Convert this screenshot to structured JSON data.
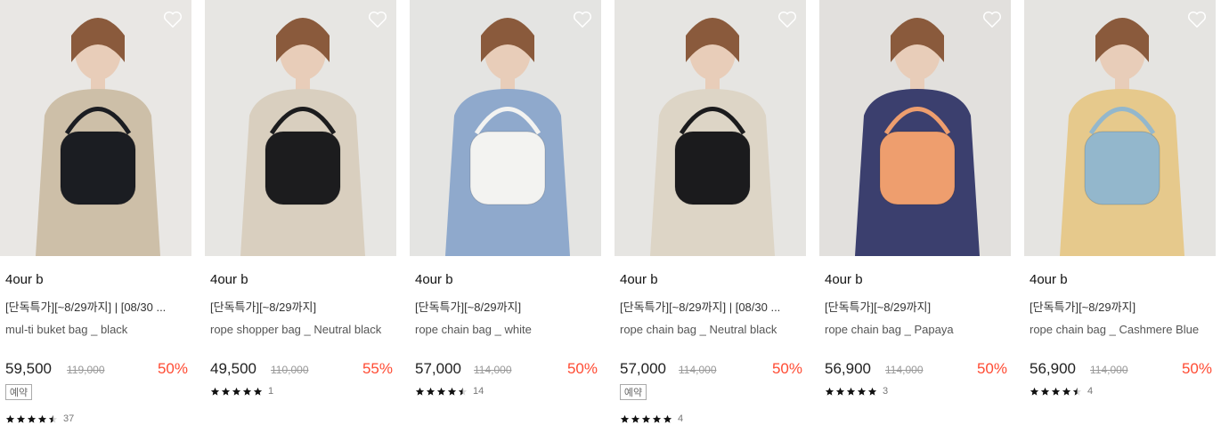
{
  "products": [
    {
      "brand": "4our b",
      "promo": "[단독특가][~8/29까지] | [08/30 ...",
      "name": "mul-ti buket bag _ black",
      "price": "59,500",
      "original_price": "119,000",
      "discount": "50%",
      "badge": "예약",
      "reviews": "37",
      "stars": "4.5",
      "bag_color": "#1b1d22",
      "bg": "#e9e7e4",
      "outfit": "#cdbfa8"
    },
    {
      "brand": "4our b",
      "promo": "[단독특가][~8/29까지]",
      "name": "rope shopper bag _ Neutral black",
      "price": "49,500",
      "original_price": "110,000",
      "discount": "55%",
      "badge": "",
      "reviews": "1",
      "stars": "5",
      "bag_color": "#1c1c1e",
      "bg": "#e7e6e3",
      "outfit": "#d9cfbf"
    },
    {
      "brand": "4our b",
      "promo": "[단독특가][~8/29까지]",
      "name": "rope chain bag _ white",
      "price": "57,000",
      "original_price": "114,000",
      "discount": "50%",
      "badge": "",
      "reviews": "14",
      "stars": "4.5",
      "bag_color": "#f3f3f1",
      "bg": "#e4e4e2",
      "outfit": "#8fa9cc"
    },
    {
      "brand": "4our b",
      "promo": "[단독특가][~8/29까지] | [08/30 ...",
      "name": "rope chain bag _ Neutral black",
      "price": "57,000",
      "original_price": "114,000",
      "discount": "50%",
      "badge": "예약",
      "reviews": "4",
      "stars": "5",
      "bag_color": "#1b1b1d",
      "bg": "#e6e5e2",
      "outfit": "#ddd5c6"
    },
    {
      "brand": "4our b",
      "promo": "[단독특가][~8/29까지]",
      "name": "rope chain bag _ Papaya",
      "price": "56,900",
      "original_price": "114,000",
      "discount": "50%",
      "badge": "",
      "reviews": "3",
      "stars": "5",
      "bag_color": "#ee9e6e",
      "bg": "#e2e0dd",
      "outfit": "#3b3f6e"
    },
    {
      "brand": "4our b",
      "promo": "[단독특가][~8/29까지]",
      "name": "rope chain bag _ Cashmere Blue",
      "price": "56,900",
      "original_price": "114,000",
      "discount": "50%",
      "badge": "",
      "reviews": "4",
      "stars": "4.5",
      "bag_color": "#93b7cc",
      "bg": "#e5e4e1",
      "outfit": "#e6c98c"
    }
  ],
  "icons": {
    "wishlist": "heart-outline-icon",
    "rating": "star-icon"
  },
  "colors": {
    "discount": "#ff4b33",
    "star": "#111111"
  }
}
